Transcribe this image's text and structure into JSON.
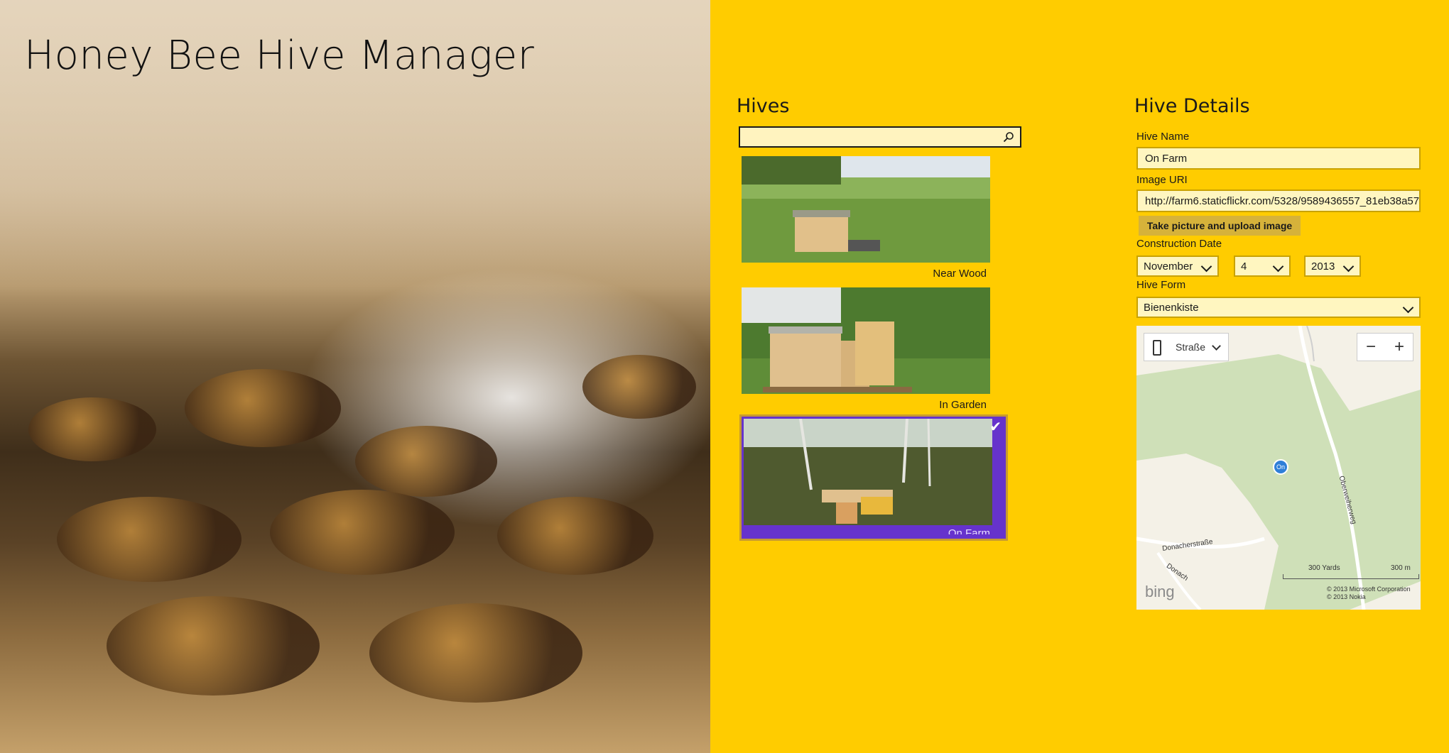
{
  "app": {
    "title": "Honey Bee Hive Manager"
  },
  "hives": {
    "heading": "Hives",
    "search": {
      "value": "",
      "placeholder": ""
    },
    "items": [
      {
        "name": "Near Wood",
        "selected": false
      },
      {
        "name": "In Garden",
        "selected": false
      },
      {
        "name": "On Farm",
        "selected": true
      }
    ],
    "selection_color": "#6633cc"
  },
  "details": {
    "heading": "Hive Details",
    "hive_name_label": "Hive Name",
    "hive_name_value": "On Farm",
    "image_uri_label": "Image URI",
    "image_uri_value": "http://farm6.staticflickr.com/5328/9589436557_81eb38a57",
    "upload_button": "Take picture and upload image",
    "construction_date_label": "Construction Date",
    "month": "November",
    "day": "4",
    "year": "2013",
    "hive_form_label": "Hive Form",
    "hive_form_value": "Bienenkiste"
  },
  "map": {
    "map_type": "Straße",
    "zoom_out": "−",
    "zoom_in": "+",
    "pin_label": "On",
    "street_1": "Donacherstraße",
    "street_2": "Donach",
    "street_3": "Oberweiherweg",
    "scale_yards": "300 Yards",
    "scale_m": "300 m",
    "logo": "bing",
    "copyright_1": "© 2013 Microsoft Corporation",
    "copyright_2": "© 2013 Nokia"
  },
  "colors": {
    "background": "#ffcc00",
    "field_bg": "#fff6c0"
  }
}
